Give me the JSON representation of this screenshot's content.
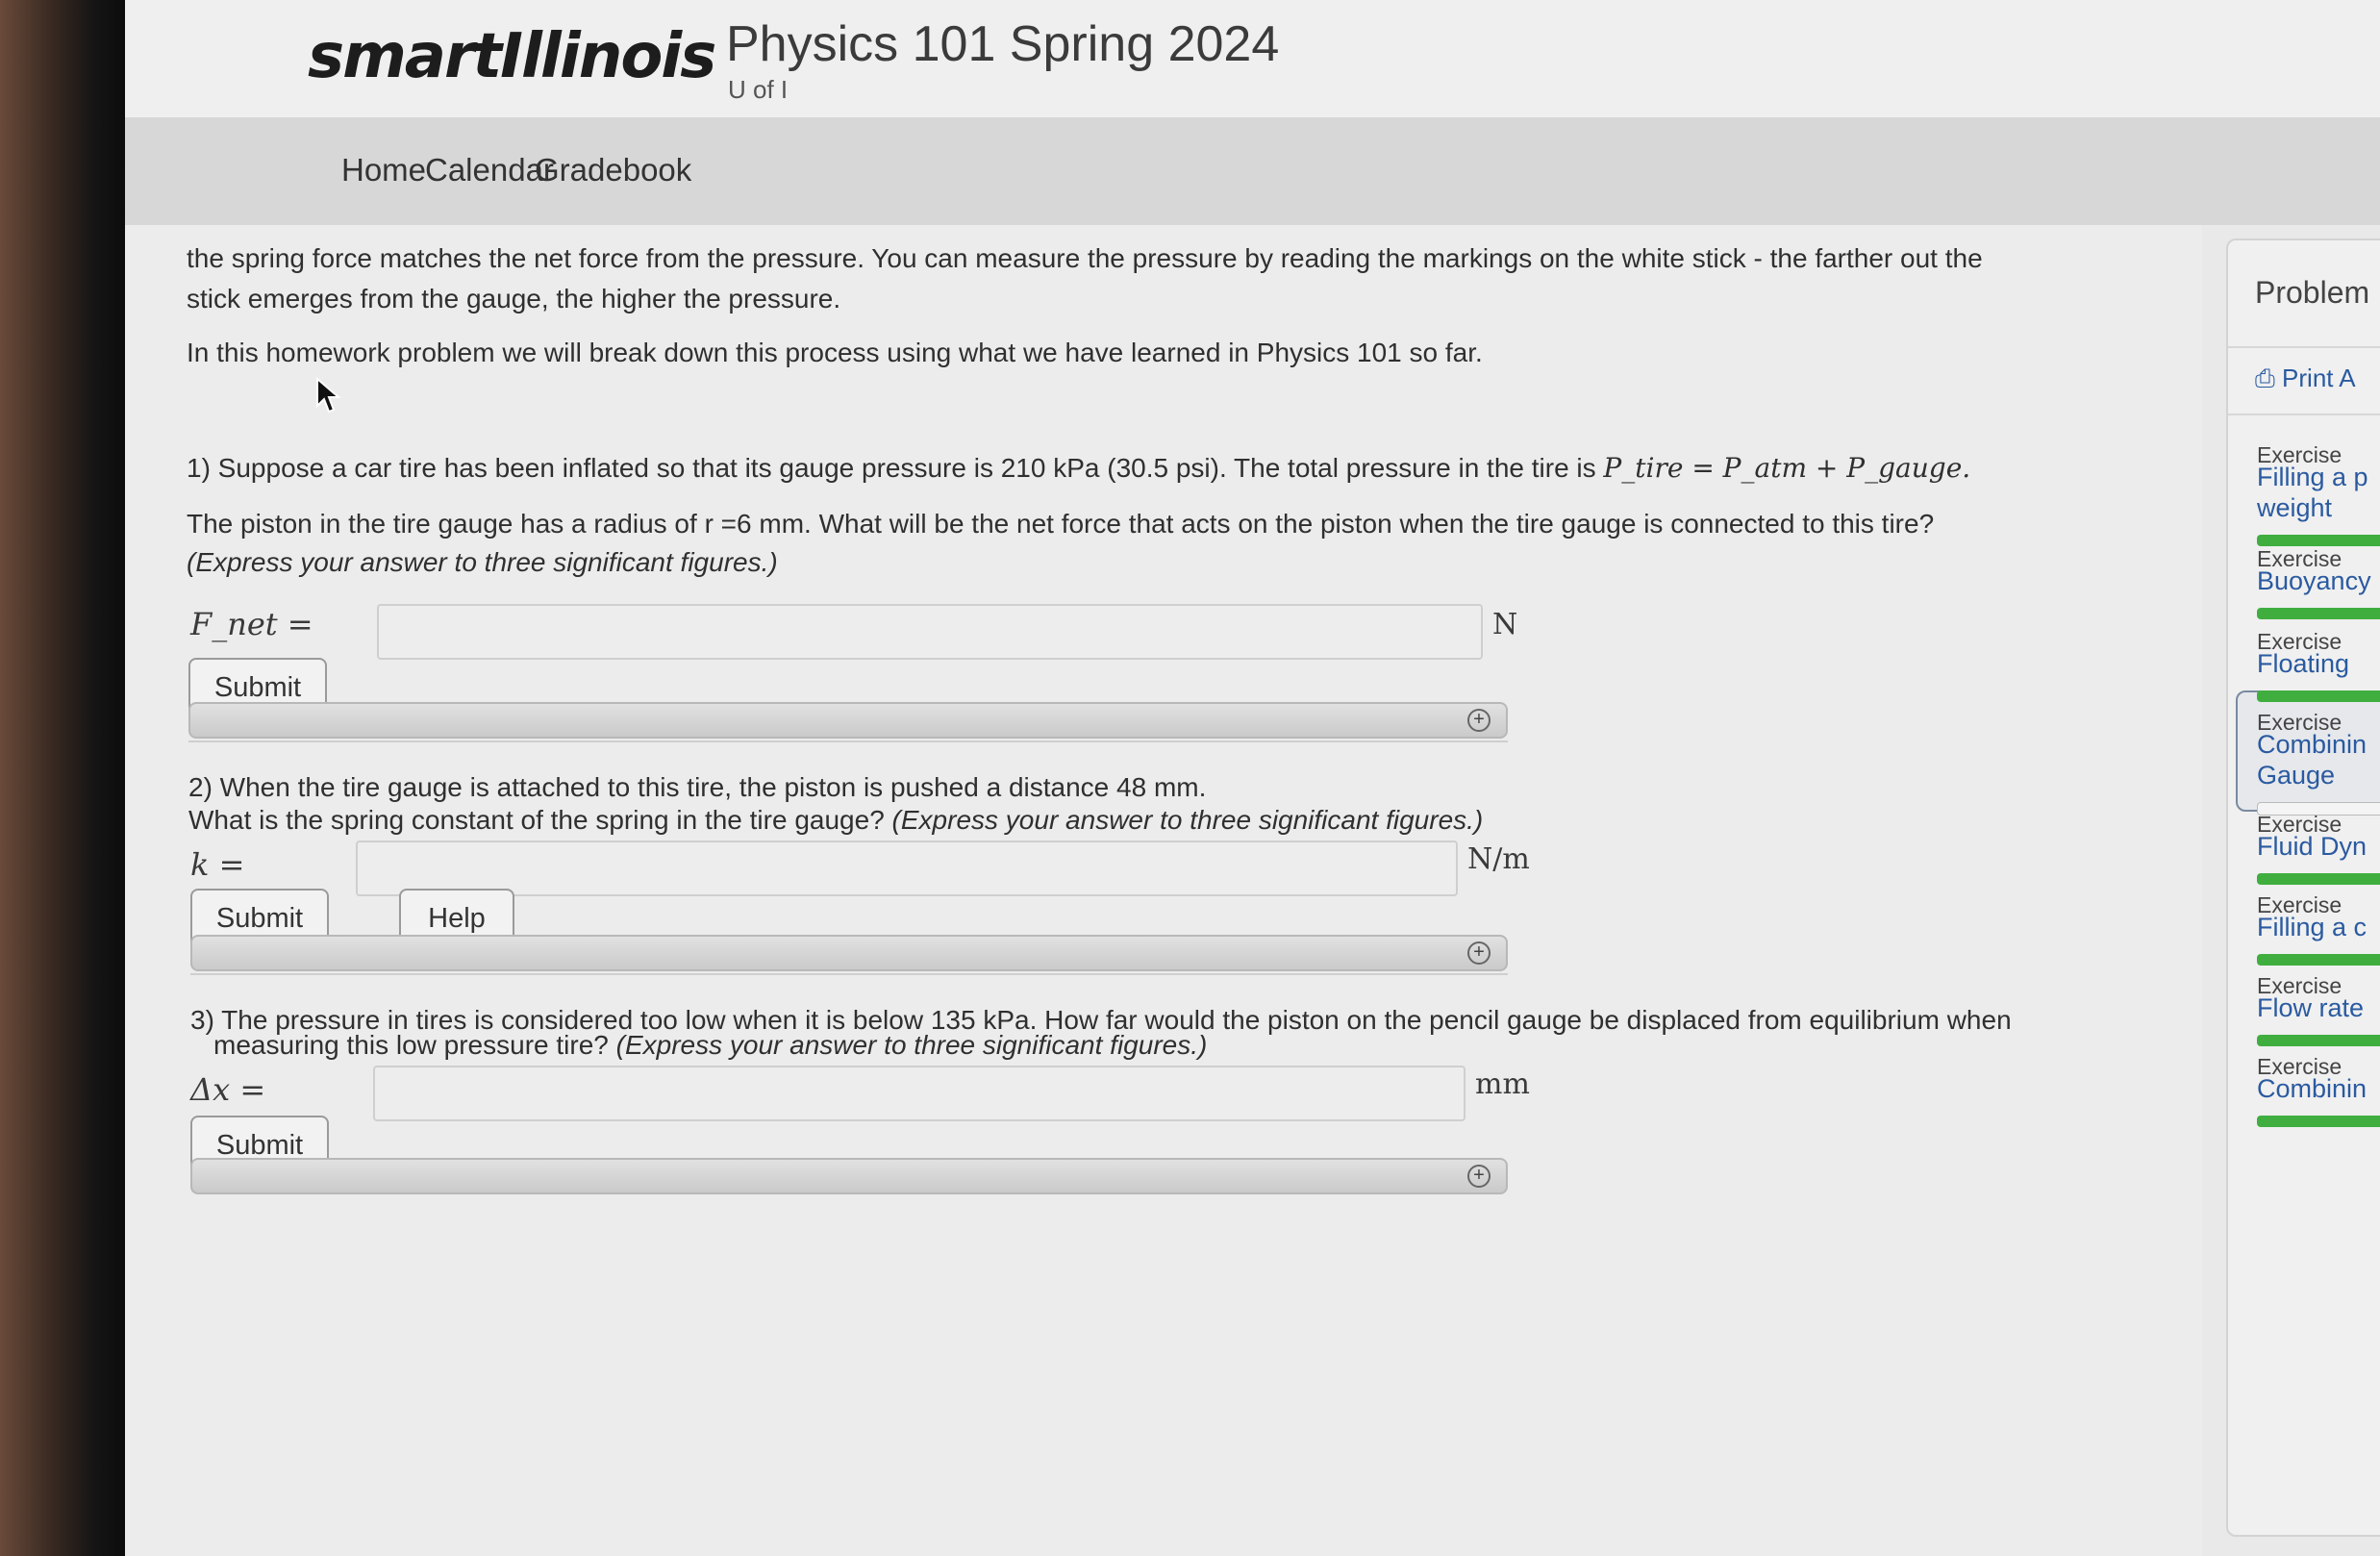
{
  "header": {
    "logo_text": "smartIllinois",
    "course_title": "Physics 101 Spring 2024",
    "course_subtitle": "U of I"
  },
  "nav": {
    "home": "Home",
    "calendar": "Calendar",
    "gradebook": "Gradebook"
  },
  "intro": {
    "line1": "the spring force matches the net force from the pressure. You can measure the pressure by reading the markings on the white stick - the farther out the",
    "line2": "stick emerges from the gauge, the higher the pressure.",
    "line3": "In this homework problem we will break down this process using what we have learned in Physics 101 so far."
  },
  "q1": {
    "text_a": "1) Suppose a car tire has been inflated so that its gauge pressure is 210 kPa (30.5 psi). The total pressure in the tire is",
    "formula": "P_tire = P_atm + P_gauge.",
    "text_b": "The piston in the tire gauge has a radius of r =6 mm. What will be the net force that acts on the piston when the tire gauge is connected to this tire?",
    "hint": "(Express your answer to three significant figures.)",
    "label": "F_net =",
    "unit": "N",
    "value": "",
    "submit": "Submit"
  },
  "q2": {
    "text_a": "2) When the tire gauge is attached to this tire, the piston is pushed a distance 48 mm.",
    "text_b": "What is the spring constant of the spring in the tire gauge?",
    "hint": "(Express your answer to three significant figures.)",
    "label": "k =",
    "unit": "N/m",
    "value": "",
    "submit": "Submit",
    "help": "Help"
  },
  "q3": {
    "text_a": "3) The pressure in tires is considered too low when it is below 135 kPa. How far would the piston on the pencil gauge be displaced from equilibrium when",
    "text_b": "measuring this low pressure tire?",
    "hint": "(Express your answer to three significant figures.)",
    "label": "Δx =",
    "unit": "mm",
    "value": "",
    "submit": "Submit"
  },
  "sidebar": {
    "title": "Problem",
    "print": "Print A",
    "exercises": [
      {
        "label": "Exercise",
        "name_1": "Filling a p",
        "name_2": "weight"
      },
      {
        "label": "Exercise",
        "name_1": "Buoyancy",
        "name_2": ""
      },
      {
        "label": "Exercise",
        "name_1": "Floating",
        "name_2": ""
      },
      {
        "label": "Exercise",
        "name_1": "Combinin",
        "name_2": "Gauge"
      },
      {
        "label": "Exercise",
        "name_1": "Fluid Dyn",
        "name_2": ""
      },
      {
        "label": "Exercise",
        "name_1": "Filling a c",
        "name_2": ""
      },
      {
        "label": "Exercise",
        "name_1": "Flow rate",
        "name_2": ""
      },
      {
        "label": "Exercise",
        "name_1": "Combinin",
        "name_2": ""
      }
    ]
  },
  "colors": {
    "link": "#2a5aa0",
    "progress": "#3fae3f",
    "nav_bg": "#d7d7d7"
  }
}
